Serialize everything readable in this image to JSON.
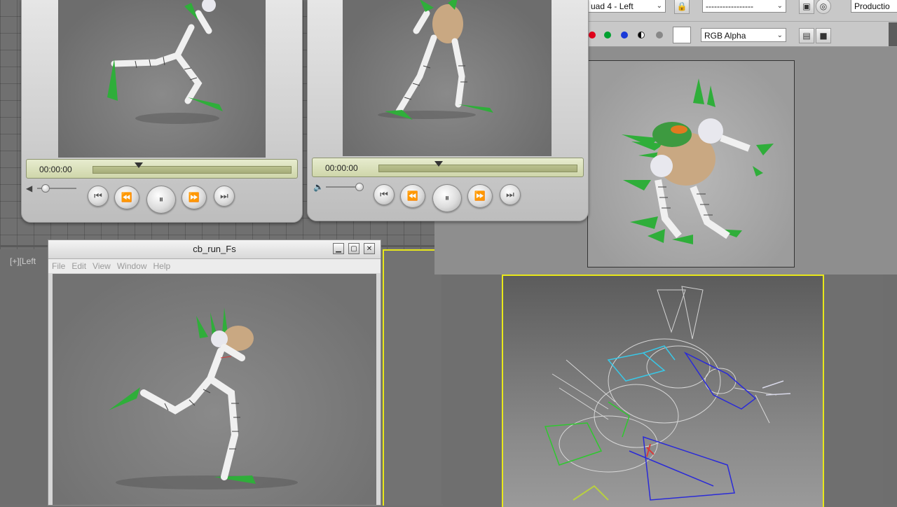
{
  "players": [
    {
      "time": "00:00:00",
      "progress": 0.23
    },
    {
      "time": "00:00:00",
      "progress": 0.3
    }
  ],
  "toolbar": {
    "viewport_select": "uad 4 - Left",
    "preset_select": "-----------------",
    "production_label": "Productio",
    "channel_select": "RGB Alpha",
    "colors": {
      "red": "#e0001b",
      "green": "#00a030",
      "blue": "#1a3ad8"
    }
  },
  "viewport": {
    "label": "[+][Left"
  },
  "media_window": {
    "title": "cb_run_Fs",
    "menu": [
      "File",
      "Edit",
      "View",
      "Window",
      "Help"
    ]
  },
  "icons": {
    "volume": "speaker-icon",
    "prev": "skip-back-icon",
    "rewind": "rewind-icon",
    "pause": "pause-icon",
    "forward": "fast-forward-icon",
    "next": "skip-forward-icon"
  }
}
